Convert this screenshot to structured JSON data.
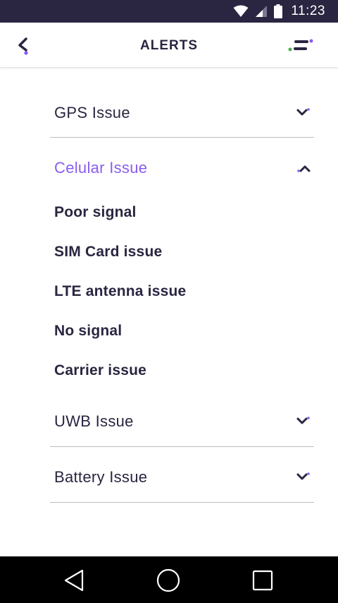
{
  "status_bar": {
    "time": "11:23",
    "bg_color": "#2a2540"
  },
  "app_bar": {
    "title": "ALERTS",
    "back_icon": "chevron-left-icon",
    "menu_icon": "menu-icon"
  },
  "sections": [
    {
      "label": "GPS Issue",
      "expanded": false
    },
    {
      "label": "Celular Issue",
      "expanded": true,
      "items": [
        "Poor signal",
        "SIM Card issue",
        "LTE antenna issue",
        "No signal",
        "Carrier issue"
      ]
    },
    {
      "label": "UWB Issue",
      "expanded": false
    },
    {
      "label": "Battery Issue",
      "expanded": false
    }
  ],
  "colors": {
    "primary_text": "#2a2540",
    "accent_purple": "#8a5cf0",
    "accent_green": "#4caf50",
    "divider": "#bdbdc4"
  },
  "nav_bar": {
    "icons": [
      "back-triangle-icon",
      "home-circle-icon",
      "recents-square-icon"
    ]
  }
}
